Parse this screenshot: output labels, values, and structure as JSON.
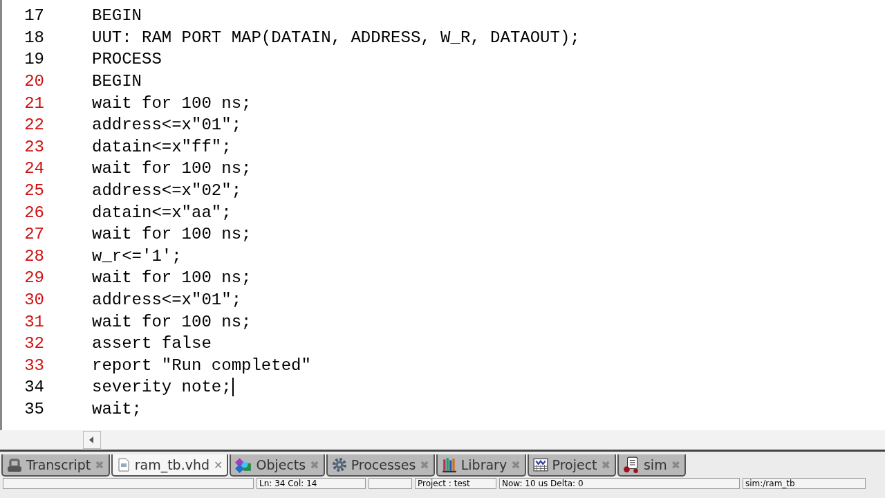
{
  "editor": {
    "lines": [
      {
        "number": "17",
        "code": "BEGIN",
        "modified": false,
        "caret": false
      },
      {
        "number": "18",
        "code": "UUT: RAM PORT MAP(DATAIN, ADDRESS, W_R, DATAOUT);",
        "modified": false,
        "caret": false
      },
      {
        "number": "19",
        "code": "PROCESS",
        "modified": false,
        "caret": false
      },
      {
        "number": "20",
        "code": "BEGIN",
        "modified": true,
        "caret": false
      },
      {
        "number": "21",
        "code": "wait for 100 ns;",
        "modified": true,
        "caret": false
      },
      {
        "number": "22",
        "code": "address<=x\"01\";",
        "modified": true,
        "caret": false
      },
      {
        "number": "23",
        "code": "datain<=x\"ff\";",
        "modified": true,
        "caret": false
      },
      {
        "number": "24",
        "code": "wait for 100 ns;",
        "modified": true,
        "caret": false
      },
      {
        "number": "25",
        "code": "address<=x\"02\";",
        "modified": true,
        "caret": false
      },
      {
        "number": "26",
        "code": "datain<=x\"aa\";",
        "modified": true,
        "caret": false
      },
      {
        "number": "27",
        "code": "wait for 100 ns;",
        "modified": true,
        "caret": false
      },
      {
        "number": "28",
        "code": "w_r<='1';",
        "modified": true,
        "caret": false
      },
      {
        "number": "29",
        "code": "wait for 100 ns;",
        "modified": true,
        "caret": false
      },
      {
        "number": "30",
        "code": "address<=x\"01\";",
        "modified": true,
        "caret": false
      },
      {
        "number": "31",
        "code": "wait for 100 ns;",
        "modified": true,
        "caret": false
      },
      {
        "number": "32",
        "code": "assert false",
        "modified": true,
        "caret": false
      },
      {
        "number": "33",
        "code": "report \"Run completed\"",
        "modified": true,
        "caret": false
      },
      {
        "number": "34",
        "code": "severity note;",
        "modified": false,
        "caret": true
      },
      {
        "number": "35",
        "code": "wait;",
        "modified": false,
        "caret": false
      }
    ]
  },
  "tabs": [
    {
      "kind": "transcript",
      "label": "Transcript",
      "close": "✖",
      "selected": false
    },
    {
      "kind": "file",
      "label": "ram_tb.vhd",
      "close": "✕",
      "selected": true
    },
    {
      "kind": "objects",
      "label": "Objects",
      "close": "✖",
      "selected": false
    },
    {
      "kind": "processes",
      "label": "Processes",
      "close": "✖",
      "selected": false
    },
    {
      "kind": "library",
      "label": "Library",
      "close": "✖",
      "selected": false
    },
    {
      "kind": "project",
      "label": "Project",
      "close": "✖",
      "selected": false
    },
    {
      "kind": "sim",
      "label": "sim",
      "close": "✖",
      "selected": false
    }
  ],
  "status_bar": {
    "position": "Ln: 34 Col: 14",
    "project": "Project : test",
    "time": "Now: 10 us  Delta: 0",
    "scope": "sim:/ram_tb"
  }
}
